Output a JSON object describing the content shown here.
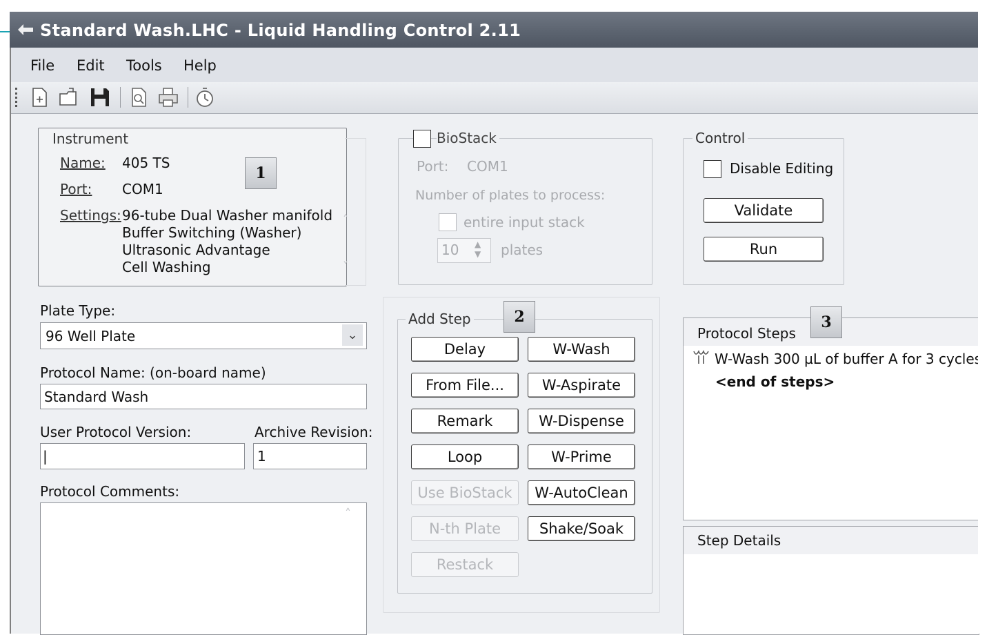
{
  "window": {
    "title": "Standard Wash.LHC - Liquid Handling Control 2.11"
  },
  "menu": [
    "File",
    "Edit",
    "Tools",
    "Help"
  ],
  "toolbar": {
    "icons": [
      "new-icon",
      "open-icon",
      "save-icon",
      "preview-icon",
      "print-icon",
      "timer-icon"
    ]
  },
  "badges": {
    "one": "1",
    "two": "2",
    "three": "3"
  },
  "instrument": {
    "group_label": "Instrument",
    "name_label": "Name:",
    "name_value": "405 TS",
    "port_label": "Port:",
    "port_value": "COM1",
    "settings_label": "Settings:",
    "settings": [
      "96-tube Dual Washer manifold",
      "Buffer Switching (Washer)",
      "Ultrasonic Advantage",
      "Cell Washing"
    ]
  },
  "biostack": {
    "label": "BioStack",
    "port_label": "Port:",
    "port_value": "COM1",
    "plates_label": "Number of plates to process:",
    "entire_label": "entire input stack",
    "plates_count": "10",
    "plates_unit": "plates"
  },
  "control": {
    "group_label": "Control",
    "disable_editing": "Disable Editing",
    "validate": "Validate",
    "run": "Run"
  },
  "form": {
    "plate_type_label": "Plate Type:",
    "plate_type_value": "96 Well Plate",
    "protocol_name_label": "Protocol Name:  (on-board name)",
    "protocol_name_value": "Standard Wash",
    "user_version_label": "User Protocol Version:",
    "user_version_value": "|",
    "archive_label": "Archive Revision:",
    "archive_value": "1",
    "comments_label": "Protocol Comments:"
  },
  "add_step": {
    "label": "Add Step",
    "left": [
      {
        "text": "Delay",
        "enabled": true
      },
      {
        "text": "From File...",
        "enabled": true
      },
      {
        "text": "Remark",
        "enabled": true
      },
      {
        "text": "Loop",
        "enabled": true
      },
      {
        "text": "Use BioStack",
        "enabled": false
      },
      {
        "text": "N-th Plate",
        "enabled": false
      },
      {
        "text": "Restack",
        "enabled": false
      }
    ],
    "right": [
      {
        "text": "W-Wash",
        "enabled": true
      },
      {
        "text": "W-Aspirate",
        "enabled": true
      },
      {
        "text": "W-Dispense",
        "enabled": true
      },
      {
        "text": "W-Prime",
        "enabled": true
      },
      {
        "text": "W-AutoClean",
        "enabled": true
      },
      {
        "text": "Shake/Soak",
        "enabled": true
      }
    ]
  },
  "protocol_steps": {
    "label": "Protocol Steps",
    "steps": [
      "W-Wash 300 µL of buffer A for 3 cycles"
    ],
    "end": "<end of steps>"
  },
  "step_details": {
    "label": "Step Details"
  }
}
